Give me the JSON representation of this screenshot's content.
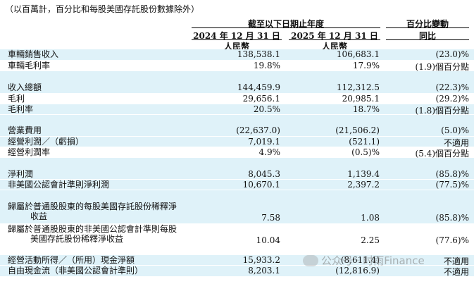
{
  "note": "（以百萬計，百分比和每股美國存託股份數據除外）",
  "header": {
    "group_title": "截至以下日期止年度",
    "change_title_1": "百分比變動",
    "col1_date": "2024 年 12 月 31 日",
    "col2_date": "2025 年 12 月 31 日",
    "change_title_2": "同比",
    "currency1": "人民幣",
    "currency2": "人民幣"
  },
  "rows": [
    {
      "label": "車輛銷售收入",
      "v2024": "138,538.1",
      "v2025": "106,683.1",
      "change": "(23.0)%"
    },
    {
      "label": "車輛毛利率",
      "v2024": "19.8%",
      "v2025": "17.9%",
      "change": "(1.9)個百分點"
    },
    {
      "label": "收入總額",
      "v2024": "144,459.9",
      "v2025": "112,312.5",
      "change": "(22.3)%"
    },
    {
      "label": "毛利",
      "v2024": "29,656.1",
      "v2025": "20,985.1",
      "change": "(29.2)%"
    },
    {
      "label": "毛利率",
      "v2024": "20.5%",
      "v2025": "18.7%",
      "change": "(1.8)個百分點"
    },
    {
      "label": "營業費用",
      "v2024": "(22,637.0)",
      "v2025": "(21,506.2)",
      "change": "(5.0)%"
    },
    {
      "label": "經營利潤／（虧損）",
      "v2024": "7,019.1",
      "v2025": "(521.1)",
      "change": "不適用"
    },
    {
      "label": "經營利潤率",
      "v2024": "4.9%",
      "v2025": "(0.5)%",
      "change": "(5.4)個百分點"
    },
    {
      "label": "淨利潤",
      "v2024": "8,045.3",
      "v2025": "1,139.4",
      "change": "(85.8)%"
    },
    {
      "label": "非美國公認會計準則淨利潤",
      "v2024": "10,670.1",
      "v2025": "2,397.2",
      "change": "(77.5)%"
    },
    {
      "label": "歸屬於普通股股東的每股美國存託股份稀釋淨",
      "label2": "收益",
      "v2024": "7.58",
      "v2025": "1.08",
      "change": "(85.8)%"
    },
    {
      "label": "歸屬於普通股股東的非美國公認會計準則每股",
      "label2": "美國存託股份稀釋淨收益",
      "v2024": "10.04",
      "v2025": "2.25",
      "change": "(77.6)%"
    },
    {
      "label": "經營活動所得／（所用）現金淨額",
      "v2024": "15,933.2",
      "v2025": "(8,611.4)",
      "change": "不適用"
    },
    {
      "label": "自由現金流（非美國公認會計準則）",
      "v2024": "8,203.1",
      "v2025": "(12,816.9)",
      "change": "不適用"
    }
  ],
  "watermark": "公众号 · 时雨Finance"
}
